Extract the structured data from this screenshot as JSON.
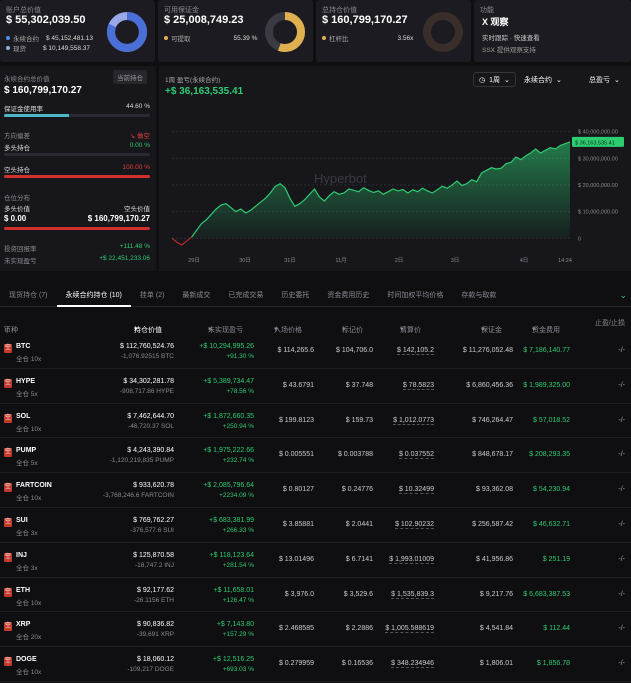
{
  "cards": {
    "account": {
      "label": "账户总价值",
      "value": "$ 55,302,039.50",
      "rows": [
        {
          "name": "永续合约",
          "value": "$ 45,152,481.13",
          "color": "#4a90e2"
        },
        {
          "name": "现货",
          "value": "$ 10,149,558.37",
          "color": "#9aa7e8"
        }
      ]
    },
    "margin": {
      "label": "可用保证金",
      "value": "$ 25,008,749.23",
      "row_name": "可提取",
      "row_value": "55.39 %",
      "color": "#e0b050"
    },
    "position": {
      "label": "总持仓价值",
      "value": "$ 160,799,170.27",
      "row_name": "杠杆比",
      "row_value": "3.56x",
      "color": "#e0b050"
    },
    "feature": {
      "label": "功能",
      "name": "X 观察",
      "line1": "实时跟踪 · 快速查看",
      "line2": "提供观察支持",
      "logo_text": "SSX"
    }
  },
  "left": {
    "perp_label": "永续合约总价值",
    "perp_badge": "当前持仓",
    "perp_value": "$ 160,799,170.27",
    "margin_usage_label": "保证金使用率",
    "margin_usage_value": "44.60 %",
    "margin_usage_pct": 44.6,
    "direction_label": "方向偏差",
    "direction_value": "做空",
    "long_label": "多头持仓",
    "long_value": "0.00 %",
    "long_pct": 0,
    "short_label": "空头持仓",
    "short_value": "100.00 %",
    "short_pct": 100,
    "dist_label": "仓位分布",
    "long_value_label": "多头价值",
    "short_value_label": "空头价值",
    "long_value_amt": "$ 0.00",
    "short_value_amt": "$ 160,799,170.27",
    "roe_label": "投资回报率",
    "roe_value": "+111.48 %",
    "upnl_label": "未实现盈亏",
    "upnl_value": "+$ 22,451,233.06"
  },
  "chart": {
    "title": "1周 盈亏(永续合约)",
    "value": "+$ 36,163,535.41",
    "controls": [
      "1周",
      "永续合约",
      "总盈亏"
    ],
    "watermark": "Hyperbot",
    "chart_data": {
      "type": "area",
      "x_ticks": [
        "29日",
        "30日",
        "31日",
        "11月",
        "2日",
        "3日",
        "4日",
        "14:24"
      ],
      "y_ticks": [
        "$ 40,000,000.00",
        "$ 30,000,000.00",
        "$ 20,000,000.00",
        "$ 10,000,000.00",
        "0"
      ],
      "ylim": [
        -4000000,
        44000000
      ],
      "last_label": "$ 36,163,535.41",
      "series": [
        {
          "values": [
            0,
            -1500000,
            -2500000,
            -1000000,
            500000,
            3000000,
            5500000,
            7000000,
            9000000,
            11000000,
            12500000,
            13000000,
            11500000,
            10000000,
            11000000,
            9500000,
            10500000,
            12000000,
            13500000,
            15000000,
            17000000,
            19500000,
            20500000,
            19000000,
            15000000,
            12000000,
            13000000,
            14500000,
            16500000,
            18500000,
            15500000,
            14000000,
            16000000,
            17500000,
            16500000,
            17000000,
            18500000,
            18000000,
            17500000,
            19000000,
            18000000,
            17200000,
            17800000,
            16500000,
            17500000,
            18500000,
            17800000,
            18300000,
            17000000,
            18200000,
            17500000,
            18800000,
            17800000,
            17000000,
            18200000,
            19500000,
            18800000,
            20000000,
            21500000,
            19800000,
            20500000,
            22000000,
            21200000,
            24500000,
            25500000,
            26500000,
            26000000,
            26300000,
            28000000,
            28500000,
            30500000,
            29500000,
            31000000,
            32000000,
            33500000,
            32000000,
            33000000,
            34000000,
            33500000,
            34800000,
            35500000,
            36163535
          ]
        }
      ]
    }
  },
  "tabs": [
    "现货持仓 (7)",
    "永续合约持仓 (10)",
    "挂单 (2)",
    "最新成交",
    "已完成交易",
    "历史委托",
    "资金费用历史",
    "时间加权平均价格",
    "存款与取款"
  ],
  "active_tab": 1,
  "table": {
    "headers": [
      "币种",
      "持仓价值",
      "未实现盈亏",
      "入场价格",
      "标记价",
      "清算价",
      "保证金",
      "资金费用",
      "止盈/止损"
    ],
    "rows": [
      {
        "coin": "BTC",
        "lev": "全仓 10x",
        "pos": "$ 112,760,524.76",
        "size": "-1,076.92515 BTC",
        "upnl": "+$ 10,294,995.26",
        "roe": "+91.30 %",
        "entry": "$ 114,265.6",
        "mark": "$ 104,706.0",
        "liq": "$ 142,105.2",
        "margin": "$ 11,276,052.48",
        "funding": "$ 7,186,140.77",
        "tp": "-/-"
      },
      {
        "coin": "HYPE",
        "lev": "全仓 5x",
        "pos": "$ 34,302,281.78",
        "size": "-908,717.86 HYPE",
        "upnl": "+$ 5,389,734.47",
        "roe": "+78.56 %",
        "entry": "$ 43.6791",
        "mark": "$ 37.748",
        "liq": "$ 78.5823",
        "margin": "$ 6,860,456.36",
        "funding": "$ 1,989,325.00",
        "tp": "-/-"
      },
      {
        "coin": "SOL",
        "lev": "全仓 10x",
        "pos": "$ 7,462,644.70",
        "size": "-46,720.37 SOL",
        "upnl": "+$ 1,872,660.35",
        "roe": "+250.94 %",
        "entry": "$ 199.8123",
        "mark": "$ 159.73",
        "liq": "$ 1,012.0773",
        "margin": "$ 746,264.47",
        "funding": "$ 57,018.52",
        "tp": "-/-"
      },
      {
        "coin": "PUMP",
        "lev": "全仓 5x",
        "pos": "$ 4,243,390.84",
        "size": "-1,120,219,835 PUMP",
        "upnl": "+$ 1,975,222.66",
        "roe": "+232.74 %",
        "entry": "$ 0.005551",
        "mark": "$ 0.003788",
        "liq": "$ 0.037552",
        "margin": "$ 848,678.17",
        "funding": "$ 208,293.35",
        "tp": "-/-"
      },
      {
        "coin": "FARTCOIN",
        "lev": "全仓 10x",
        "pos": "$ 933,620.78",
        "size": "-3,768,246.6 FARTCOIN",
        "upnl": "+$ 2,085,796.64",
        "roe": "+2234.09 %",
        "entry": "$ 0.80127",
        "mark": "$ 0.24776",
        "liq": "$ 10.32499",
        "margin": "$ 93,362.08",
        "funding": "$ 54,230.94",
        "tp": "-/-"
      },
      {
        "coin": "SUI",
        "lev": "全仓 3x",
        "pos": "$ 769,762.27",
        "size": "-376,577.6 SUI",
        "upnl": "+$ 683,381.99",
        "roe": "+266.33 %",
        "entry": "$ 3.85881",
        "mark": "$ 2.0441",
        "liq": "$ 102.90232",
        "margin": "$ 256,587.42",
        "funding": "$ 46,632.71",
        "tp": "-/-"
      },
      {
        "coin": "INJ",
        "lev": "全仓 3x",
        "pos": "$ 125,870.58",
        "size": "-18,747.2 INJ",
        "upnl": "+$ 118,123.64",
        "roe": "+281.54 %",
        "entry": "$ 13.01496",
        "mark": "$ 6.7141",
        "liq": "$ 1,993.01009",
        "margin": "$ 41,956.86",
        "funding": "$ 251.19",
        "tp": "-/-"
      },
      {
        "coin": "ETH",
        "lev": "全仓 10x",
        "pos": "$ 92,177.62",
        "size": "-26.1156 ETH",
        "upnl": "+$ 11,658.01",
        "roe": "+126.47 %",
        "entry": "$ 3,976.0",
        "mark": "$ 3,529.6",
        "liq": "$ 1,535,839.3",
        "margin": "$ 9,217.76",
        "funding": "$ 6,683,387.53",
        "tp": "-/-"
      },
      {
        "coin": "XRP",
        "lev": "全仓 20x",
        "pos": "$ 90,836.82",
        "size": "-39,691 XRP",
        "upnl": "+$ 7,143.80",
        "roe": "+157.29 %",
        "entry": "$ 2.468585",
        "mark": "$ 2.2886",
        "liq": "$ 1,005.588619",
        "margin": "$ 4,541.84",
        "funding": "$ 112.44",
        "tp": "-/-"
      },
      {
        "coin": "DOGE",
        "lev": "全仓 10x",
        "pos": "$ 18,060.12",
        "size": "-109,217 DOGE",
        "upnl": "+$ 12,516.25",
        "roe": "+693.03 %",
        "entry": "$ 0.279959",
        "mark": "$ 0.16536",
        "liq": "$ 348.234946",
        "margin": "$ 1,806.01",
        "funding": "$ 1,856.78",
        "tp": "-/-"
      }
    ]
  }
}
